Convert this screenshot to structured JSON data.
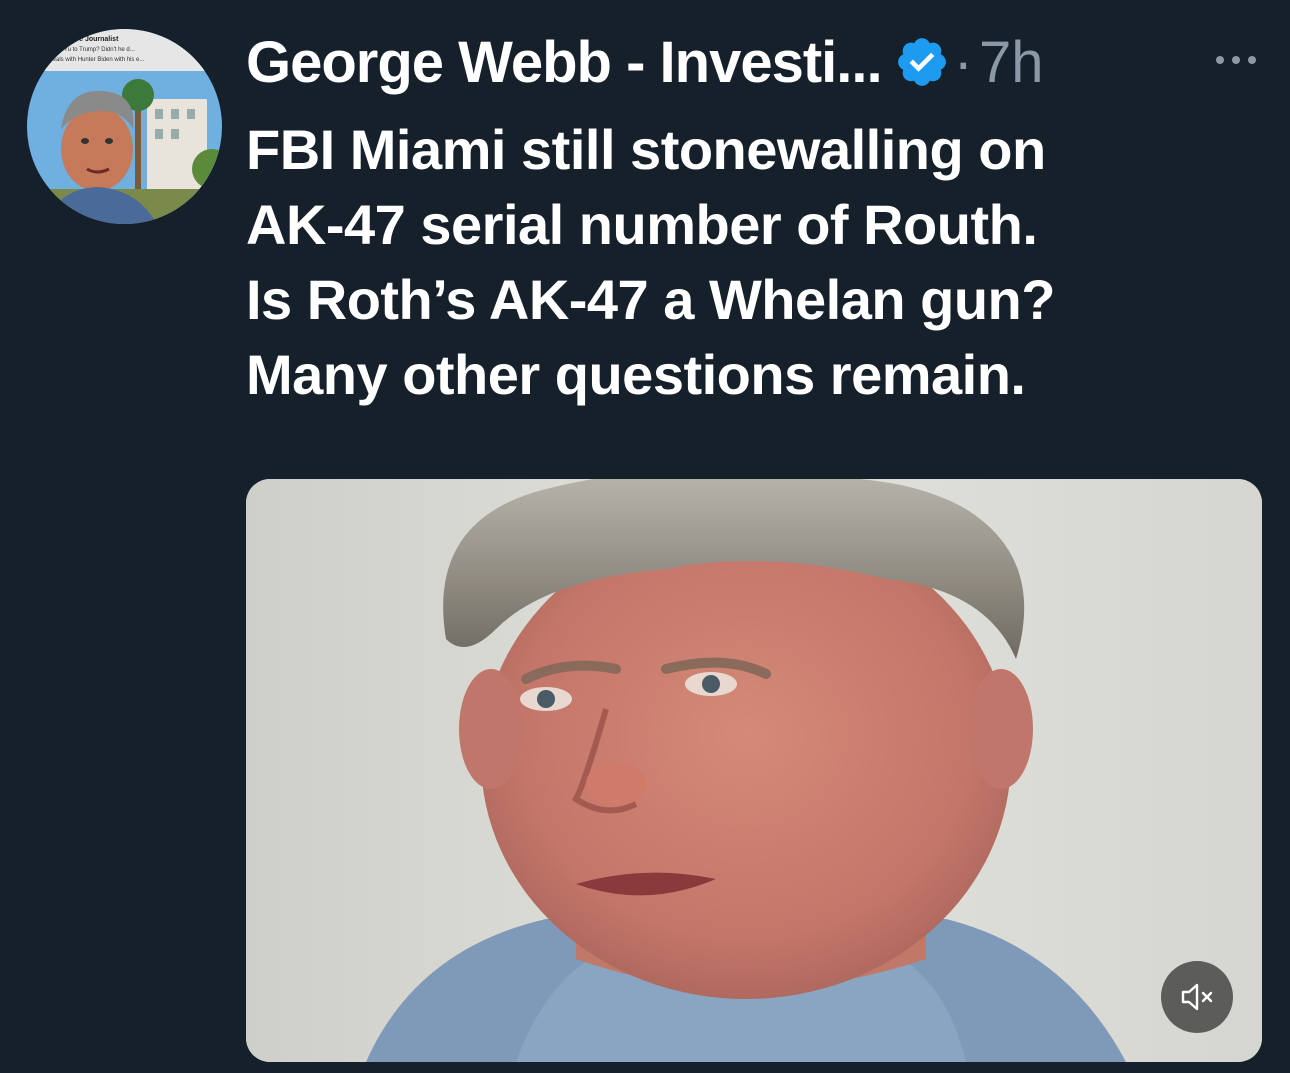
{
  "tweet": {
    "author_display_name": "George Webb - Investi...",
    "verified_icon": "verified-badge-icon",
    "separator": "·",
    "timestamp": "7h",
    "more_icon": "more-options-icon",
    "text_lines": [
      "FBI Miami still stonewalling on",
      "AK-47 serial number of Routh.",
      "Is Roth’s AK-47 a Whelan gun?",
      "Many other questions remain."
    ]
  },
  "avatar": {
    "banner_text_lines": [
      "...igative Journalist",
      "...ame of Yu to Trump? Didn't he d...",
      "...ons deals with Hunter Biden with his e..."
    ]
  },
  "media": {
    "type": "video",
    "mute_icon": "speaker-muted-icon"
  },
  "colors": {
    "background": "#15202b",
    "text_primary": "#ffffff",
    "text_secondary": "#8b98a5",
    "verified_blue": "#1d9bf0"
  }
}
